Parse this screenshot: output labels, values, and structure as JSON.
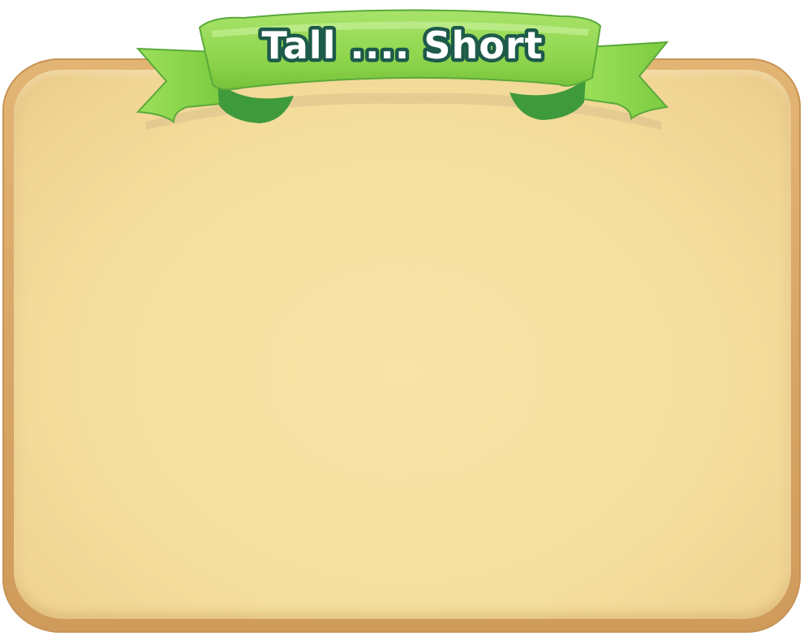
{
  "title": "Tall .... Short",
  "colors": {
    "board_frame": "#d7a565",
    "board_fill": "#f5df9e",
    "ribbon_green": "#8fd64d",
    "ribbon_dark": "#3f9a3c",
    "title_outline": "#1d5a4a",
    "title_fill": "#ffffff"
  }
}
